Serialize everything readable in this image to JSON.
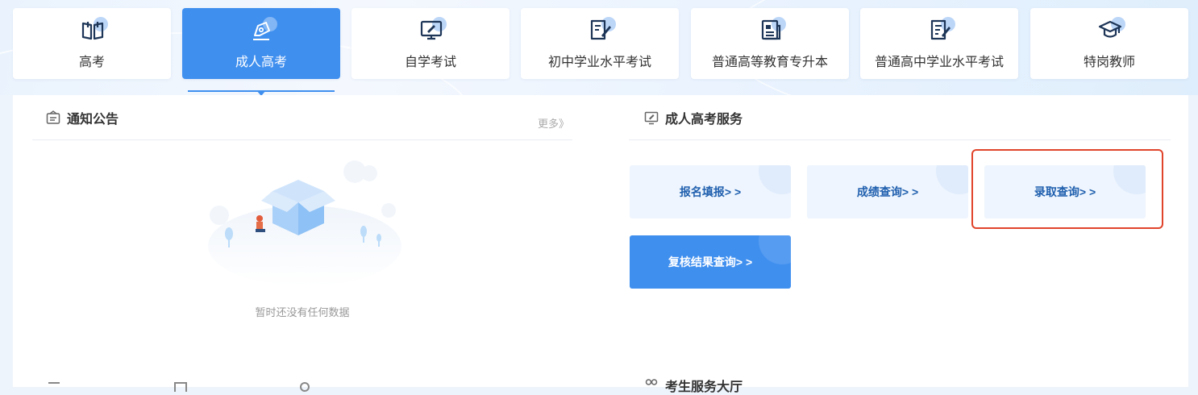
{
  "tabs": [
    {
      "label": "高考",
      "icon": "open-book-icon"
    },
    {
      "label": "成人高考",
      "icon": "pen-nib-icon",
      "active": true
    },
    {
      "label": "自学考试",
      "icon": "monitor-pen-icon"
    },
    {
      "label": "初中学业水平考试",
      "icon": "notebook-pen-icon"
    },
    {
      "label": "普通高等教育专升本",
      "icon": "newspaper-icon"
    },
    {
      "label": "普通高中学业水平考试",
      "icon": "document-edit-icon"
    },
    {
      "label": "特岗教师",
      "icon": "graduation-cap-icon"
    }
  ],
  "notice": {
    "title": "通知公告",
    "more": "更多》",
    "empty_text": "暂时还没有任何数据"
  },
  "service": {
    "title": "成人高考服务",
    "buttons": [
      {
        "label": "报名填报> >"
      },
      {
        "label": "成绩查询> >"
      },
      {
        "label": "录取查询> >",
        "highlighted": true
      },
      {
        "label": "复核结果查询> >",
        "primary": true
      }
    ]
  },
  "bottom": {
    "section_title_partial": "考生服务大厅"
  },
  "colors": {
    "accent": "#3f8fef",
    "button_text": "#1f5fae",
    "highlight": "#e0442b"
  }
}
